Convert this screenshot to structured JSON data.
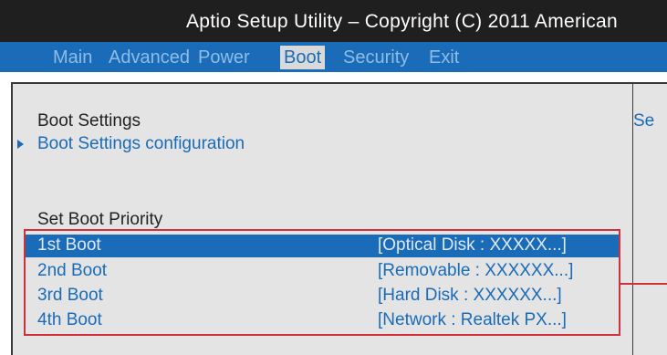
{
  "title": "Aptio Setup Utility – Copyright (C) 2011 American",
  "tabs": [
    {
      "label": "Main"
    },
    {
      "label": "Advanced"
    },
    {
      "label": "Power"
    },
    {
      "label": "Boot"
    },
    {
      "label": "Security"
    },
    {
      "label": "Exit"
    }
  ],
  "active_tab": "Boot",
  "section": {
    "heading": "Boot Settings",
    "submenu_label": "Boot Settings configuration",
    "priority_heading": "Set Boot Priority"
  },
  "help_text": "Se",
  "boot_rows": [
    {
      "label": "1st  Boot",
      "value": "[Optical  Disk : XXXXX...]"
    },
    {
      "label": "2nd Boot",
      "value": "[Removable : XXXXXX...]"
    },
    {
      "label": "3rd Boot",
      "value": "[Hard  Disk : XXXXXX...]"
    },
    {
      "label": "4th Boot",
      "value": "[Network : Realtek PX...]"
    }
  ],
  "colors": {
    "accent": "#1a6bb8",
    "highlight_box": "#d0303a",
    "panel_bg": "#e4e4e4"
  }
}
